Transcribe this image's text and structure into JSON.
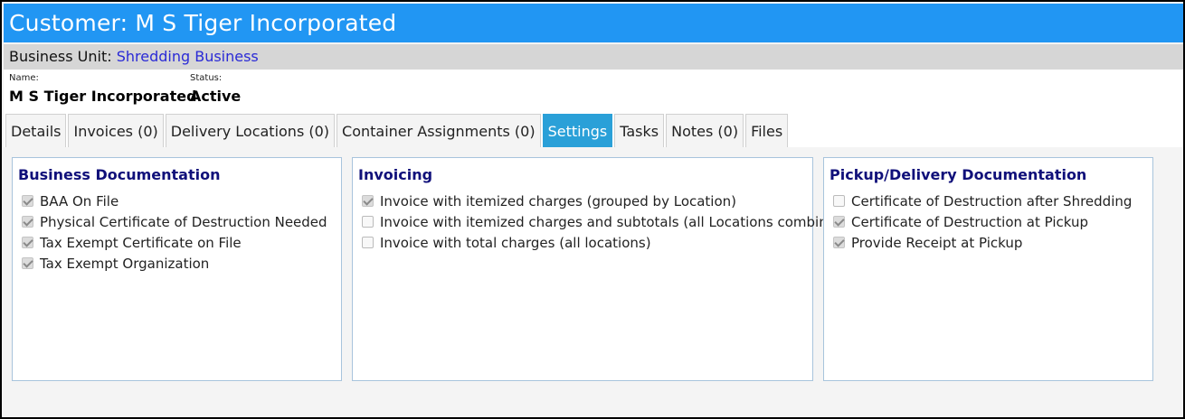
{
  "header": {
    "title": "Customer: M S Tiger Incorporated"
  },
  "business_unit": {
    "label": "Business Unit:",
    "value": "Shredding Business"
  },
  "info": {
    "name_label": "Name:",
    "name_value": "M S Tiger Incorporated",
    "status_label": "Status:",
    "status_value": "Active"
  },
  "tabs": [
    {
      "label": "Details"
    },
    {
      "label": "Invoices (0)"
    },
    {
      "label": "Delivery Locations (0)"
    },
    {
      "label": "Container Assignments (0)"
    },
    {
      "label": "Settings",
      "active": true
    },
    {
      "label": "Tasks"
    },
    {
      "label": "Notes (0)"
    },
    {
      "label": "Files"
    }
  ],
  "panels": {
    "business_documentation": {
      "title": "Business Documentation",
      "options": [
        {
          "label": "BAA On File",
          "checked": true
        },
        {
          "label": "Physical Certificate of Destruction Needed",
          "checked": true
        },
        {
          "label": "Tax Exempt Certificate on File",
          "checked": true
        },
        {
          "label": "Tax Exempt Organization",
          "checked": true
        }
      ]
    },
    "invoicing": {
      "title": "Invoicing",
      "options": [
        {
          "label": "Invoice with itemized charges (grouped by Location)",
          "checked": true
        },
        {
          "label": "Invoice with itemized charges and subtotals (all Locations combined)",
          "checked": false
        },
        {
          "label": "Invoice with total charges (all locations)",
          "checked": false
        }
      ]
    },
    "pickup_delivery": {
      "title": "Pickup/Delivery Documentation",
      "options": [
        {
          "label": "Certificate of Destruction after Shredding",
          "checked": false
        },
        {
          "label": "Certificate of Destruction at Pickup",
          "checked": true
        },
        {
          "label": "Provide Receipt at Pickup",
          "checked": true
        }
      ]
    }
  },
  "colors": {
    "title_bar": "#2196f3",
    "active_tab": "#2aa0d8",
    "section_heading": "#10107a",
    "link": "#2a2ad6"
  }
}
